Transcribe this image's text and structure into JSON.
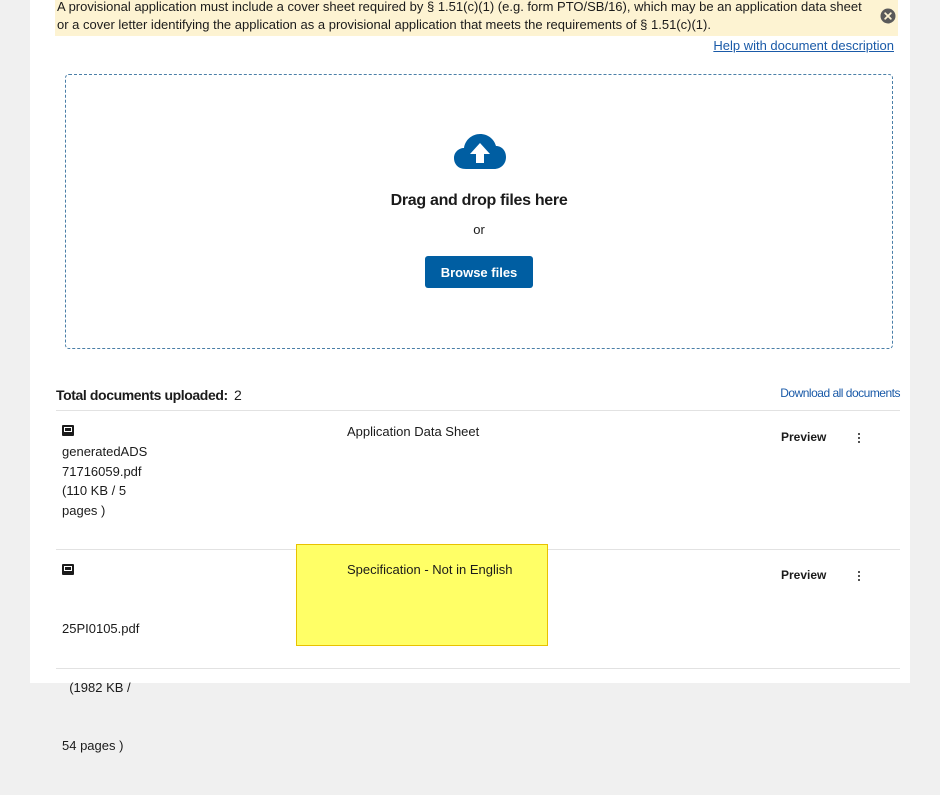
{
  "notice": {
    "line1": "A provisional application must include a cover sheet required by § 1.51(c)(1) (e.g. form PTO/SB/16), which may be an application data sheet",
    "line2": "or a cover letter identifying the application as a provisional application that meets the requirements of § 1.51(c)(1).",
    "close_icon": "close-circle-icon"
  },
  "help_link": "Help with document description",
  "dropzone": {
    "icon": "cloud-upload-icon",
    "title": "Drag and drop files here",
    "or": "or",
    "browse_label": "Browse files"
  },
  "summary": {
    "total_label": "Total documents uploaded:",
    "total_count": "2",
    "download_all": "Download all documents"
  },
  "documents": [
    {
      "file_lines": [
        "generatedADS",
        "71716059.pdf",
        "(110 KB / 5",
        "pages )"
      ],
      "description": "Application Data Sheet",
      "preview_label": "Preview"
    },
    {
      "file_lines": [
        "25PI0105.pdf",
        "  (1982 KB /",
        "54 pages )"
      ],
      "description": "Specification - Not in English",
      "preview_label": "Preview"
    }
  ],
  "colors": {
    "primary": "#005ea2",
    "link": "#1a5aa8",
    "notice_bg": "#fdf3d2",
    "highlight": "#ffff66"
  }
}
